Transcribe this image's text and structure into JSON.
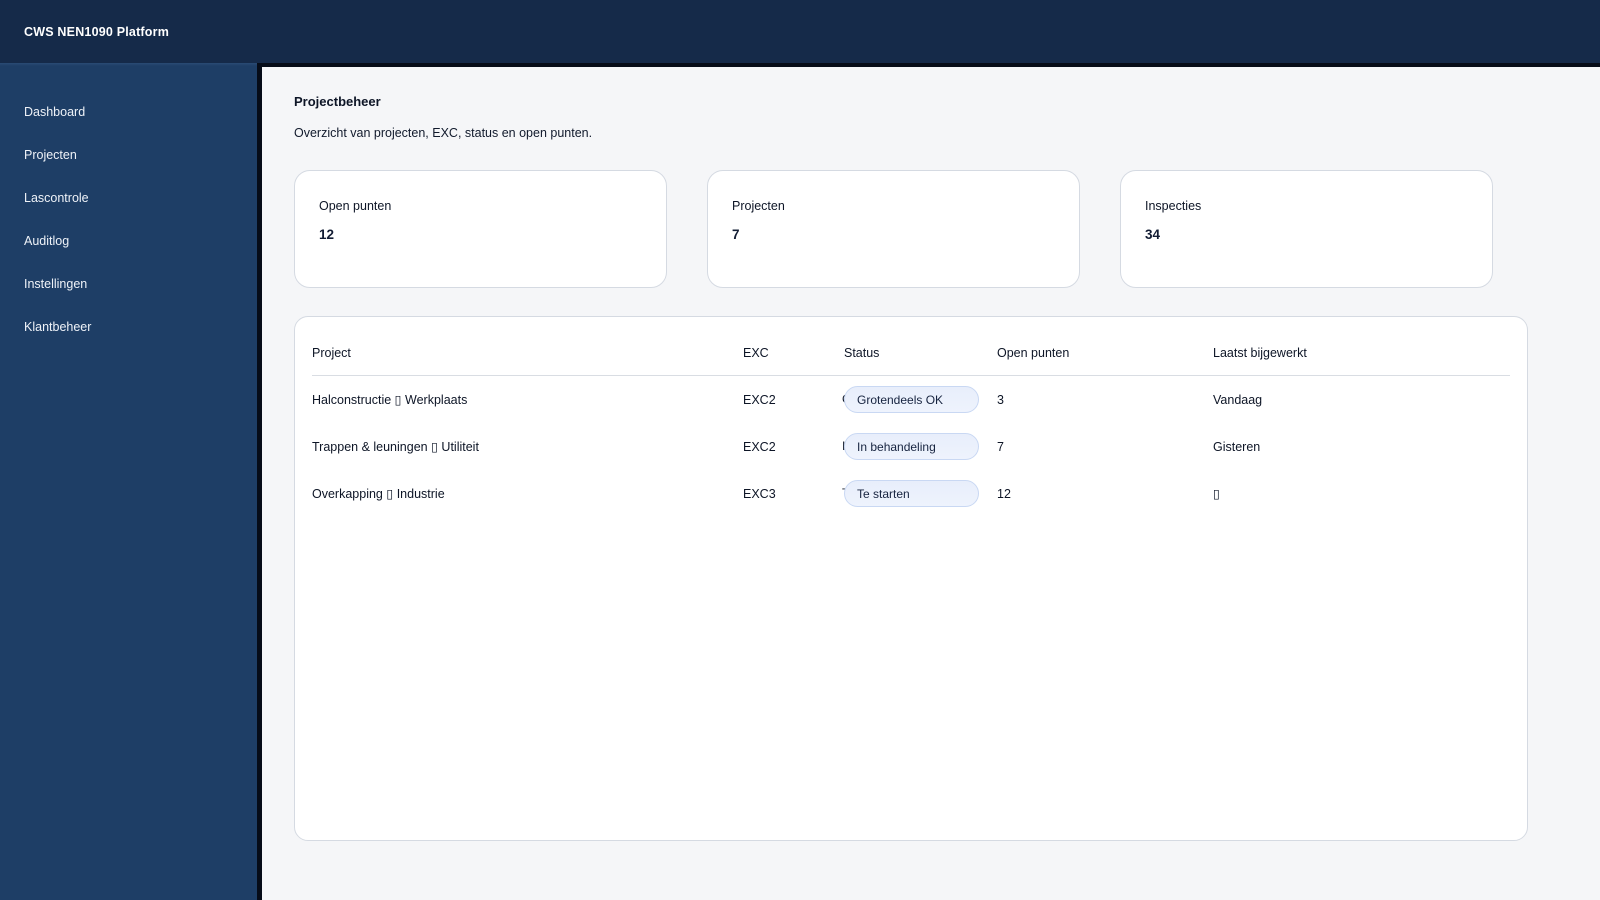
{
  "app": {
    "title": "CWS NEN1090 Platform"
  },
  "sidebar": {
    "items": [
      {
        "label": "Dashboard"
      },
      {
        "label": "Projecten"
      },
      {
        "label": "Lascontrole"
      },
      {
        "label": "Auditlog"
      },
      {
        "label": "Instellingen"
      },
      {
        "label": "Klantbeheer"
      }
    ]
  },
  "page": {
    "title": "Projectbeheer",
    "subtitle": "Overzicht van projecten, EXC, status en open punten."
  },
  "stats": [
    {
      "label": "Open punten",
      "value": "12"
    },
    {
      "label": "Projecten",
      "value": "7"
    },
    {
      "label": "Inspecties",
      "value": "34"
    }
  ],
  "table": {
    "columns": [
      "Project",
      "EXC",
      "Status",
      "Open punten",
      "Laatst bijgewerkt"
    ],
    "rows": [
      {
        "project": "Halconstructie ▯ Werkplaats",
        "exc": "EXC2",
        "status": "Grotendeels OK",
        "open_punten": "3",
        "laatst_bijgewerkt": "Vandaag"
      },
      {
        "project": "Trappen & leuningen ▯ Utiliteit",
        "exc": "EXC2",
        "status": "In behandeling",
        "open_punten": "7",
        "laatst_bijgewerkt": "Gisteren"
      },
      {
        "project": "Overkapping ▯ Industrie",
        "exc": "EXC3",
        "status": "Te starten",
        "open_punten": "12",
        "laatst_bijgewerkt": "▯"
      }
    ]
  },
  "colors": {
    "topbar_bg": "#152a49",
    "sidebar_bg": "#1e3e66",
    "content_bg": "#f5f6f8",
    "card_border": "#d5dae2",
    "pill_bg": "#e8eefb",
    "pill_border": "#c9d8f3",
    "text": "#0d1526"
  }
}
